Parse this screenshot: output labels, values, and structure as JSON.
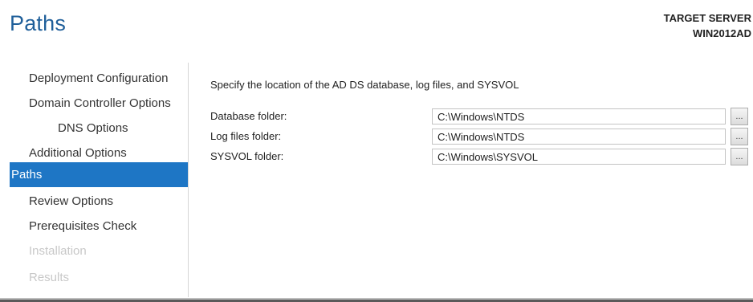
{
  "page": {
    "title": "Paths",
    "target_server_label": "TARGET SERVER",
    "target_server_name": "WIN2012AD"
  },
  "sidebar": {
    "items": [
      {
        "label": "Deployment Configuration",
        "state": "normal"
      },
      {
        "label": "Domain Controller Options",
        "state": "normal"
      },
      {
        "label": "DNS Options",
        "state": "normal"
      },
      {
        "label": "Additional Options",
        "state": "normal"
      },
      {
        "label": "Paths",
        "state": "selected"
      },
      {
        "label": "Review Options",
        "state": "normal"
      },
      {
        "label": "Prerequisites Check",
        "state": "normal"
      },
      {
        "label": "Installation",
        "state": "disabled"
      },
      {
        "label": "Results",
        "state": "disabled"
      }
    ]
  },
  "main": {
    "heading": "Specify the location of the AD DS database, log files, and SYSVOL",
    "fields": [
      {
        "label": "Database folder:",
        "value": "C:\\Windows\\NTDS",
        "browse_label": "..."
      },
      {
        "label": "Log files folder:",
        "value": "C:\\Windows\\NTDS",
        "browse_label": "..."
      },
      {
        "label": "SYSVOL folder:",
        "value": "C:\\Windows\\SYSVOL",
        "browse_label": "..."
      }
    ]
  },
  "colors": {
    "title": "#1f5f9a",
    "selected_background": "#1e76c5",
    "selected_text": "#ffffff",
    "disabled_text": "#c8c8c8"
  }
}
